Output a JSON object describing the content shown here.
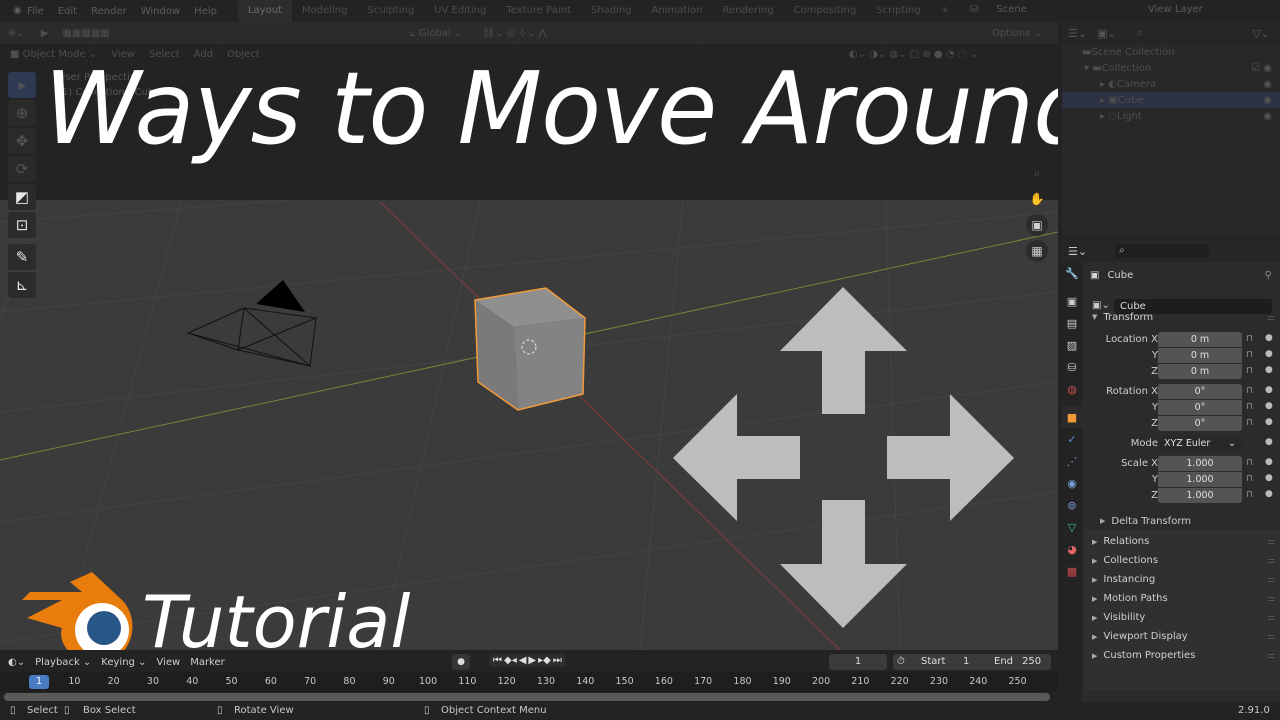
{
  "topbar": {
    "menus": [
      "File",
      "Edit",
      "Render",
      "Window",
      "Help"
    ],
    "workspaces": [
      "Layout",
      "Modeling",
      "Sculpting",
      "UV Editing",
      "Texture Paint",
      "Shading",
      "Animation",
      "Rendering",
      "Compositing",
      "Scripting",
      "+"
    ],
    "active_workspace": "Layout",
    "scene": "Scene",
    "view_layer": "View Layer"
  },
  "viewport": {
    "mode": "Object Mode",
    "menus": [
      "View",
      "Select",
      "Add",
      "Object"
    ],
    "orientation": "Global",
    "options": "Options",
    "info_line1": "User Perspective",
    "info_line2": "(1) Collection | Cube"
  },
  "overlay": {
    "title": "Ways to Move Around",
    "subtitle": "Tutorial"
  },
  "outliner": {
    "rows": [
      {
        "label": "Scene Collection"
      },
      {
        "label": "Collection"
      },
      {
        "label": "Camera"
      },
      {
        "label": "Cube",
        "selected": true
      },
      {
        "label": "Light"
      }
    ]
  },
  "properties": {
    "object_name": "Cube",
    "data_name": "Cube",
    "transform_label": "Transform",
    "location": {
      "label": "Location X",
      "x": "0 m",
      "y": "0 m",
      "z": "0 m"
    },
    "rotation": {
      "label": "Rotation X",
      "x": "0°",
      "y": "0°",
      "z": "0°"
    },
    "mode_label": "Mode",
    "mode_value": "XYZ Euler",
    "scale": {
      "label": "Scale X",
      "x": "1.000",
      "y": "1.000",
      "z": "1.000"
    },
    "axis_y": "Y",
    "axis_z": "Z",
    "delta_transform": "Delta Transform",
    "panels": [
      "Relations",
      "Collections",
      "Instancing",
      "Motion Paths",
      "Visibility",
      "Viewport Display",
      "Custom Properties"
    ]
  },
  "timeline": {
    "menus": [
      "Playback",
      "Keying",
      "View",
      "Marker"
    ],
    "current_frame": "1",
    "start_label": "Start",
    "start": "1",
    "end_label": "End",
    "end": "250",
    "ticks": [
      "10",
      "20",
      "30",
      "40",
      "50",
      "60",
      "70",
      "80",
      "90",
      "100",
      "110",
      "120",
      "130",
      "140",
      "150",
      "160",
      "170",
      "180",
      "190",
      "200",
      "210",
      "220",
      "230",
      "240",
      "250"
    ]
  },
  "status": {
    "select": "Select",
    "box_select": "Box Select",
    "rotate_view": "Rotate View",
    "context_menu": "Object Context Menu",
    "version": "2.91.0"
  },
  "colors": {
    "selection_orange": "#f29a3a",
    "active_blue": "#4a7cc3",
    "x_axis": "#8a3a3a",
    "y_axis": "#6e8a3a"
  }
}
